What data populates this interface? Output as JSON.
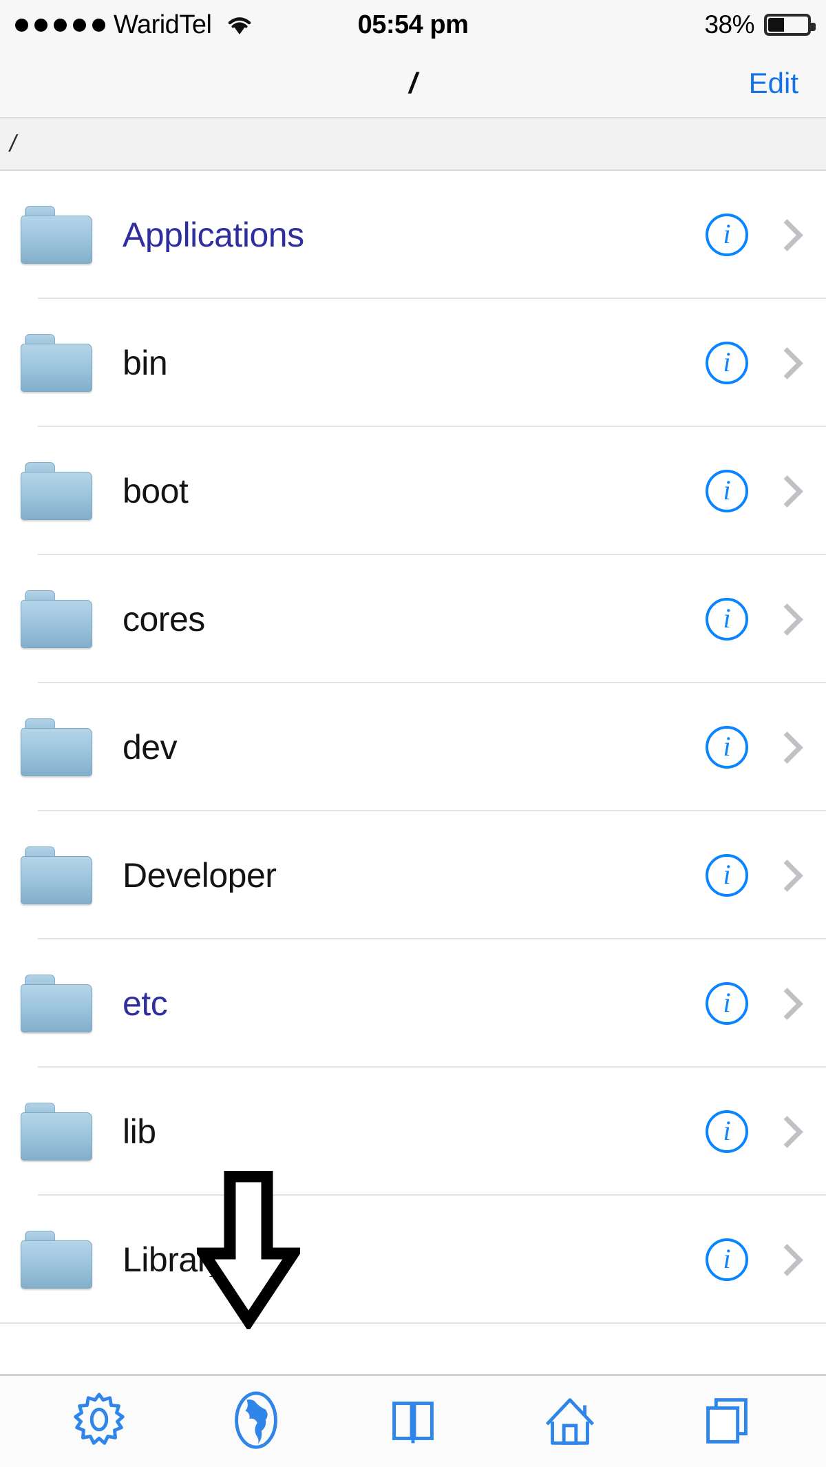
{
  "status_bar": {
    "signal_dots": 5,
    "carrier": "WaridTel",
    "wifi_icon": "wifi-icon",
    "time": "05:54 pm",
    "battery_percent": "38%",
    "battery_level": 38
  },
  "nav_bar": {
    "title": "/",
    "edit_label": "Edit",
    "accent_color": "#1473e6"
  },
  "path_bar": {
    "path": "/"
  },
  "file_list": {
    "info_glyph": "i",
    "items": [
      {
        "name": "Applications",
        "icon": "folder-icon",
        "is_link": true,
        "info": "info-icon",
        "chevron": "chevron-right-icon"
      },
      {
        "name": "bin",
        "icon": "folder-icon",
        "is_link": false,
        "info": "info-icon",
        "chevron": "chevron-right-icon"
      },
      {
        "name": "boot",
        "icon": "folder-icon",
        "is_link": false,
        "info": "info-icon",
        "chevron": "chevron-right-icon"
      },
      {
        "name": "cores",
        "icon": "folder-icon",
        "is_link": false,
        "info": "info-icon",
        "chevron": "chevron-right-icon"
      },
      {
        "name": "dev",
        "icon": "folder-icon",
        "is_link": false,
        "info": "info-icon",
        "chevron": "chevron-right-icon"
      },
      {
        "name": "Developer",
        "icon": "folder-icon",
        "is_link": false,
        "info": "info-icon",
        "chevron": "chevron-right-icon"
      },
      {
        "name": "etc",
        "icon": "folder-icon",
        "is_link": true,
        "info": "info-icon",
        "chevron": "chevron-right-icon"
      },
      {
        "name": "lib",
        "icon": "folder-icon",
        "is_link": false,
        "info": "info-icon",
        "chevron": "chevron-right-icon"
      },
      {
        "name": "Library",
        "icon": "folder-icon",
        "is_link": false,
        "info": "info-icon",
        "chevron": "chevron-right-icon"
      }
    ],
    "link_color": "#2e2e9e",
    "text_color": "#141414"
  },
  "toolbar": {
    "accent_color": "#2f86e8",
    "items": [
      {
        "icon": "gear-icon"
      },
      {
        "icon": "globe-icon"
      },
      {
        "icon": "book-icon"
      },
      {
        "icon": "home-icon"
      },
      {
        "icon": "windows-icon"
      }
    ]
  },
  "annotation": {
    "arrow": "arrow-down-icon",
    "points_at": "globe-icon",
    "color": "#000000"
  }
}
